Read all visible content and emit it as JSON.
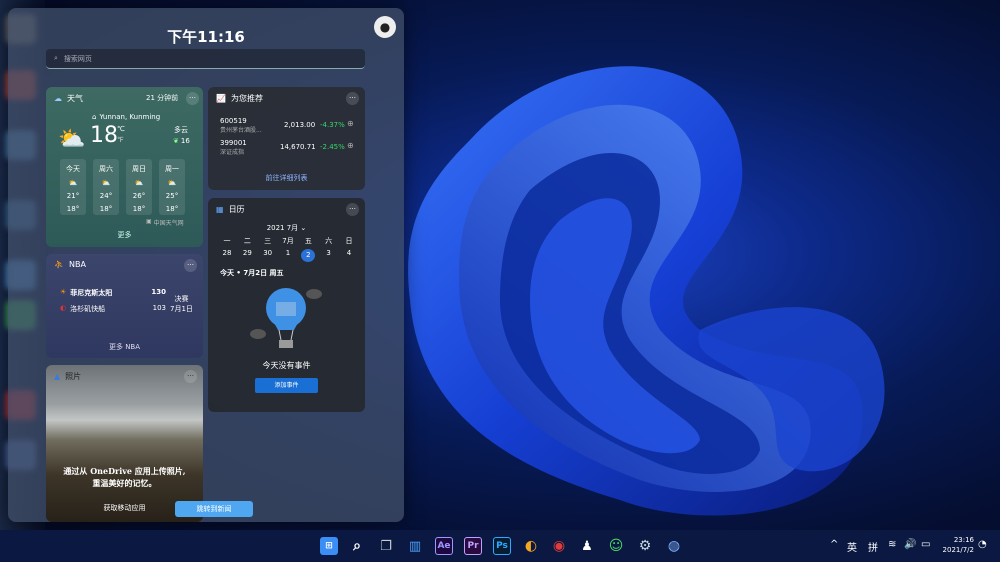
{
  "header": {
    "time": "下午11:16",
    "search_placeholder": "搜索网页"
  },
  "weather": {
    "title": "天气",
    "updated": "21 分钟前",
    "location": "Yunnan, Kunming",
    "temp": "18",
    "unit_c": "℃",
    "unit_f": "℉",
    "condition": "多云",
    "aqi": "16",
    "days": [
      {
        "name": "今天",
        "hi": "21°",
        "lo": "18°"
      },
      {
        "name": "周六",
        "hi": "24°",
        "lo": "18°"
      },
      {
        "name": "周日",
        "hi": "26°",
        "lo": "18°"
      },
      {
        "name": "周一",
        "hi": "25°",
        "lo": "18°"
      }
    ],
    "source": "中国天气网",
    "more": "更多"
  },
  "stocks": {
    "title": "为您推荐",
    "items": [
      {
        "code": "600519",
        "name": "贵州茅台酒股...",
        "price": "2,013.00",
        "change": "-4.37%"
      },
      {
        "code": "399001",
        "name": "深证成指",
        "price": "14,670.71",
        "change": "-2.45%"
      }
    ],
    "link": "前往详细列表"
  },
  "calendar": {
    "title": "日历",
    "month": "2021 7月",
    "weekdays": [
      "一",
      "二",
      "三",
      "7月",
      "五",
      "六",
      "日"
    ],
    "dates": [
      "28",
      "29",
      "30",
      "1",
      "2",
      "3",
      "4"
    ],
    "today_label": "今天 • 7月2日 周五",
    "no_events": "今天没有事件",
    "add_button": "添加事件"
  },
  "nba": {
    "title": "NBA",
    "teams": [
      {
        "name": "菲尼克斯太阳",
        "score": "130"
      },
      {
        "name": "洛杉矶快船",
        "score": "103"
      }
    ],
    "status": "决赛",
    "date": "7月1日",
    "more": "更多 NBA"
  },
  "photos": {
    "title": "照片",
    "message_line1": "通过从 OneDrive 应用上传照片,",
    "message_line2": "重温美好的记忆。",
    "get_app": "获取移动应用",
    "news_button": "跳转到新闻"
  },
  "taskbar": {
    "apps": [
      {
        "icon": "start-icon",
        "label": "⊞",
        "color": "#3a8ef6"
      },
      {
        "icon": "search-icon",
        "label": "⌕",
        "color": "#ffffff"
      },
      {
        "icon": "task-view-icon",
        "label": "❐",
        "color": "#cccccc"
      },
      {
        "icon": "widgets-icon",
        "label": "▥",
        "color": "#4da3ff"
      },
      {
        "icon": "after-effects-icon",
        "label": "Ae",
        "color": "#9999ff"
      },
      {
        "icon": "premiere-icon",
        "label": "Pr",
        "color": "#c2a0ff"
      },
      {
        "icon": "photoshop-icon",
        "label": "Ps",
        "color": "#31a8ff"
      },
      {
        "icon": "browser-icon",
        "label": "◐",
        "color": "#f5a623"
      },
      {
        "icon": "netease-music-icon",
        "label": "◉",
        "color": "#e13b3b"
      },
      {
        "icon": "qq-icon",
        "label": "♟",
        "color": "#ffffff"
      },
      {
        "icon": "wechat-icon",
        "label": "☺",
        "color": "#4cd964"
      },
      {
        "icon": "steam-icon",
        "label": "⚙",
        "color": "#c7d5e0"
      },
      {
        "icon": "app-icon",
        "label": "◍",
        "color": "#7fb2ff"
      }
    ],
    "tray": {
      "chevron": "^",
      "lang": "英",
      "ime": "拼",
      "time": "23:16",
      "date": "2021/7/2"
    }
  }
}
